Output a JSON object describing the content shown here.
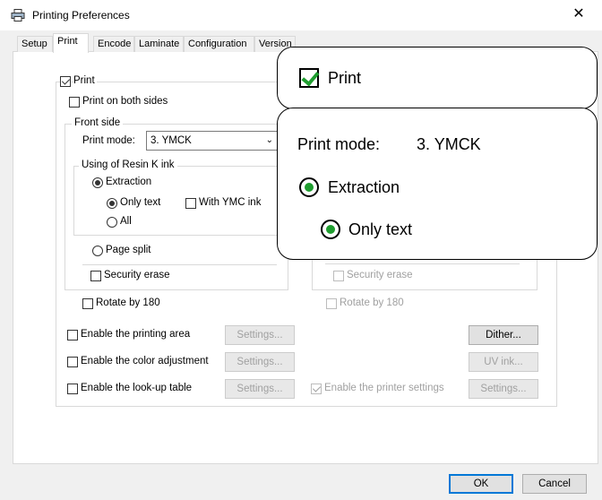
{
  "window": {
    "title": "Printing Preferences",
    "close_glyph": "✕"
  },
  "tabs": [
    {
      "label": "Setup",
      "active": false
    },
    {
      "label": "Print",
      "active": true
    },
    {
      "label": "Encode",
      "active": false
    },
    {
      "label": "Laminate",
      "active": false
    },
    {
      "label": "Configuration",
      "active": false
    },
    {
      "label": "Version",
      "active": false
    }
  ],
  "print": {
    "print_label": "Print",
    "print_checked": true,
    "both_sides_label": "Print on both sides",
    "front_side_label": "Front side",
    "print_mode_label": "Print mode:",
    "print_mode_value": "3. YMCK",
    "resin_group_label": "Using of Resin K ink",
    "extraction_label": "Extraction",
    "only_text_label": "Only text",
    "with_ymc_label": "With YMC ink",
    "all_label": "All",
    "page_split_label": "Page split",
    "security_erase_label": "Security erase",
    "rotate_label": "Rotate by 180",
    "back_security_erase_label": "Security erase",
    "back_rotate_label": "Rotate by 180"
  },
  "options": {
    "printing_area_label": "Enable the printing area",
    "color_adjust_label": "Enable the color adjustment",
    "lookup_label": "Enable the look-up table",
    "printer_settings_label": "Enable the printer settings",
    "printer_settings_checked": true,
    "settings_label": "Settings...",
    "dither_label": "Dither...",
    "uv_ink_label": "UV ink..."
  },
  "footer": {
    "ok_label": "OK",
    "cancel_label": "Cancel"
  },
  "callouts": {
    "print_label": "Print",
    "print_mode_label": "Print mode:",
    "print_mode_value": "3. YMCK",
    "extraction_label": "Extraction",
    "only_text_label": "Only text"
  },
  "colors": {
    "accent": "#0078d7",
    "highlight_green": "#1f9d2f"
  }
}
